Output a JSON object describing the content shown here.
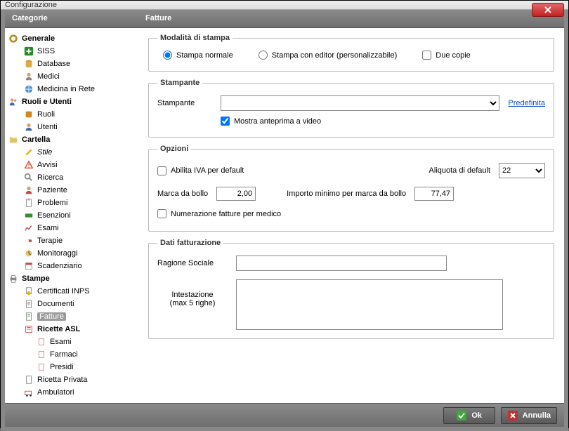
{
  "window": {
    "title": "Configurazione"
  },
  "headers": {
    "categories": "Categorie",
    "content": "Fatture"
  },
  "sidebar": {
    "groups": [
      {
        "label": "Generale",
        "children": [
          {
            "label": "SISS"
          },
          {
            "label": "Database"
          },
          {
            "label": "Medici"
          },
          {
            "label": "Medicina in Rete"
          }
        ]
      },
      {
        "label": "Ruoli e Utenti",
        "children": [
          {
            "label": "Ruoli"
          },
          {
            "label": "Utenti"
          }
        ]
      },
      {
        "label": "Cartella",
        "children": [
          {
            "label": "Stile",
            "italic": true
          },
          {
            "label": "Avvisi"
          },
          {
            "label": "Ricerca"
          },
          {
            "label": "Paziente"
          },
          {
            "label": "Problemi"
          },
          {
            "label": "Esenzioni"
          },
          {
            "label": "Esami"
          },
          {
            "label": "Terapie"
          },
          {
            "label": "Monitoraggi"
          },
          {
            "label": "Scadenziario"
          }
        ]
      },
      {
        "label": "Stampe",
        "children": [
          {
            "label": "Certificati INPS"
          },
          {
            "label": "Documenti"
          },
          {
            "label": "Fatture",
            "selected": true
          },
          {
            "label": "Ricette ASL",
            "bold": true,
            "children": [
              {
                "label": "Esami"
              },
              {
                "label": "Farmaci"
              },
              {
                "label": "Presidi"
              }
            ]
          },
          {
            "label": "Ricetta Privata"
          },
          {
            "label": "Ambulatori"
          }
        ]
      }
    ]
  },
  "groupboxes": {
    "print_mode": {
      "legend": "Modalità di stampa",
      "options": {
        "normal": "Stampa normale",
        "editor": "Stampa con editor (personalizzabile)",
        "two_copies": "Due copie"
      }
    },
    "printer": {
      "legend": "Stampante",
      "label": "Stampante",
      "default_link": "Predefinita",
      "preview_label": "Mostra anteprima a video"
    },
    "options": {
      "legend": "Opzioni",
      "enable_vat": "Abilita IVA per default",
      "rate_label": "Aliquota di default",
      "rate_value": "22",
      "stamp_label": "Marca da bollo",
      "stamp_value": "2,00",
      "min_import_label": "Importo minimo per marca da bollo",
      "min_import_value": "77,47",
      "numbering_label": "Numerazione fatture per medico"
    },
    "billing": {
      "legend": "Dati fatturazione",
      "company_label": "Ragione Sociale",
      "header_label": "Intestazione",
      "header_sub": "(max 5 righe)"
    }
  },
  "buttons": {
    "ok": "Ok",
    "cancel": "Annulla"
  }
}
